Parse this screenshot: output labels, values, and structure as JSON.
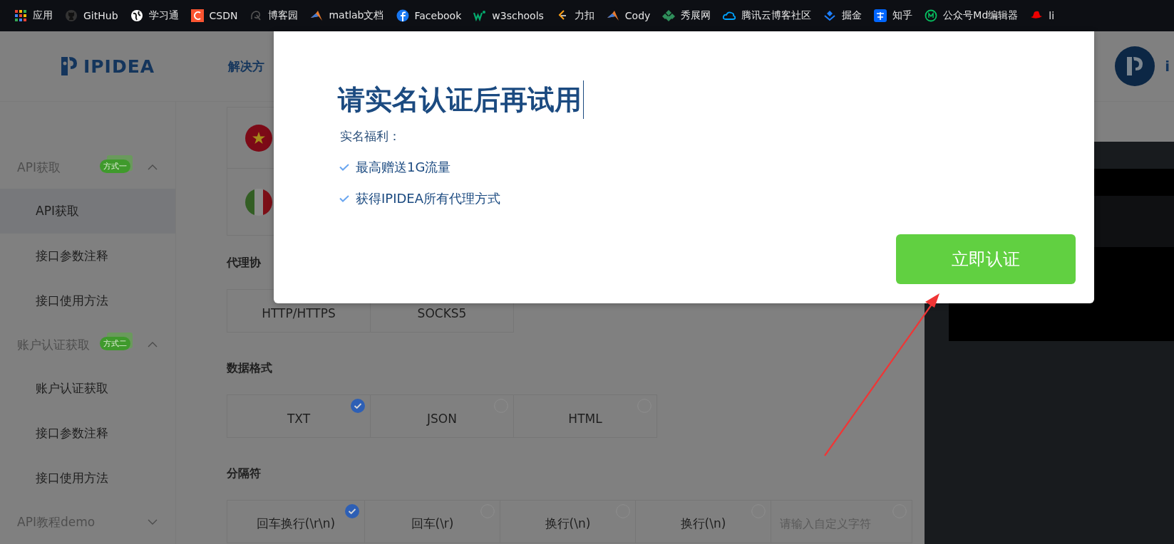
{
  "bookmarks": [
    {
      "label": "应用"
    },
    {
      "label": "GitHub"
    },
    {
      "label": "学习通"
    },
    {
      "label": "CSDN"
    },
    {
      "label": "博客园"
    },
    {
      "label": "matlab文档"
    },
    {
      "label": "Facebook"
    },
    {
      "label": "w3schools"
    },
    {
      "label": "力扣"
    },
    {
      "label": "Cody"
    },
    {
      "label": "秀展网"
    },
    {
      "label": "腾讯云博客社区"
    },
    {
      "label": "掘金"
    },
    {
      "label": "知乎"
    },
    {
      "label": "公众号Md编辑器"
    },
    {
      "label": "li"
    }
  ],
  "header": {
    "logo": "IPIDEA",
    "nav_item": "解决方",
    "user_name": "i"
  },
  "sidebar": {
    "groups": [
      {
        "title": "API获取",
        "badge": "方式一",
        "expanded": true,
        "items": [
          {
            "label": "API获取",
            "selected": true
          },
          {
            "label": "接口参数注释",
            "selected": false
          },
          {
            "label": "接口使用方法",
            "selected": false
          }
        ]
      },
      {
        "title": "账户认证获取",
        "badge": "方式二",
        "expanded": true,
        "items": [
          {
            "label": "账户认证获取",
            "selected": false
          },
          {
            "label": "接口参数注释",
            "selected": false
          },
          {
            "label": "接口使用方法",
            "selected": false
          }
        ]
      },
      {
        "title": "API教程demo",
        "expanded": false
      }
    ]
  },
  "sections": [
    {
      "title": "代理协",
      "options": [
        {
          "kind": "option",
          "label": "HTTP/HTTPS"
        },
        {
          "kind": "option",
          "label": "SOCKS5"
        }
      ]
    },
    {
      "title": "数据格式",
      "options": [
        {
          "kind": "option",
          "label": "TXT",
          "selected": true
        },
        {
          "kind": "option",
          "label": "JSON",
          "selected": false
        },
        {
          "kind": "option",
          "label": "HTML",
          "selected": false
        }
      ]
    },
    {
      "title": "分隔符",
      "options": [
        {
          "kind": "option",
          "label": "回车换行(\\r\\n)",
          "selected": true
        },
        {
          "kind": "option",
          "label": "回车(\\r)",
          "selected": false
        },
        {
          "kind": "option",
          "label": "换行(\\n)",
          "selected": false
        },
        {
          "kind": "option",
          "label": "换行(\\n)",
          "selected": false
        },
        {
          "kind": "input",
          "placeholder": "请输入自定义字符",
          "selected": false
        }
      ]
    }
  ],
  "modal": {
    "title": "请实名认证后再试用",
    "subtitle": "实名福利：",
    "benefits": [
      "最高赠送1G流量",
      "获得IPIDEA所有代理方式"
    ],
    "button": "立即认证"
  }
}
